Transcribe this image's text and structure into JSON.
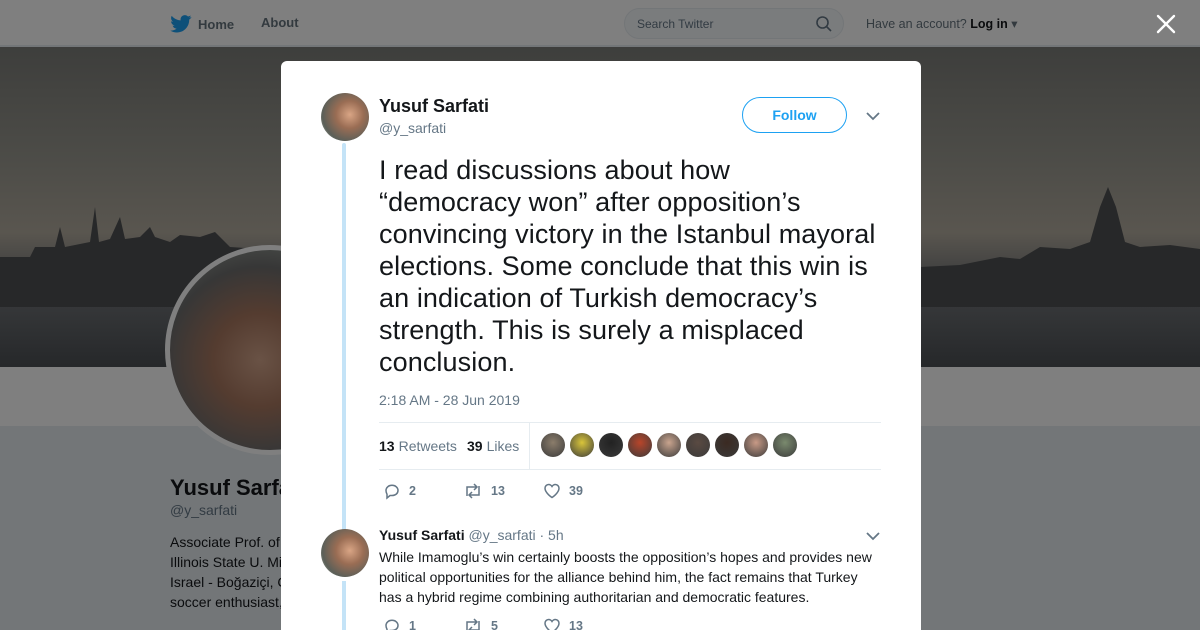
{
  "topbar": {
    "home_label": "Home",
    "about_label": "About",
    "search_placeholder": "Search Twitter",
    "account_prompt": "Have an account?",
    "login_label": "Log in"
  },
  "profile": {
    "name": "Yusuf Sarfa",
    "handle": "@y_sarfati",
    "bio_lines": [
      "Associate Prof. of",
      "Illinois State U. Mi",
      "Israel - Boğaziçi, C",
      "soccer enthusiast,"
    ]
  },
  "tweet": {
    "author_name": "Yusuf Sarfati",
    "author_handle": "@y_sarfati",
    "follow_label": "Follow",
    "text": "I read discussions about how “democracy won” after opposition’s convincing victory in the Istanbul mayoral elections. Some conclude that this win is an indication of Turkish democracy’s strength. This is surely a misplaced conclusion.",
    "timestamp": "2:18 AM - 28 Jun 2019",
    "retweets_count": "13",
    "retweets_label": "Retweets",
    "likes_count": "39",
    "likes_label": "Likes",
    "liker_colors": [
      "#8b7d6b",
      "#d9c53a",
      "#222222",
      "#b8452a",
      "#c9a48e",
      "#5a4a42",
      "#3b2a22",
      "#c89a86",
      "#7a8a6e"
    ],
    "replies": "2",
    "retweets": "13",
    "likes": "39"
  },
  "reply": {
    "author_name": "Yusuf Sarfati",
    "author_handle": "@y_sarfati",
    "time": "· 5h",
    "text": "While Imamoglu’s win certainly boosts the opposition’s hopes and provides new political opportunities for the alliance behind him, the fact remains that Turkey has a hybrid regime combining authoritarian and democratic features.",
    "replies": "1",
    "retweets": "5",
    "likes": "13"
  },
  "colors": {
    "accent": "#1da1f2",
    "muted": "#657786",
    "thread": "#c4e3f7"
  }
}
